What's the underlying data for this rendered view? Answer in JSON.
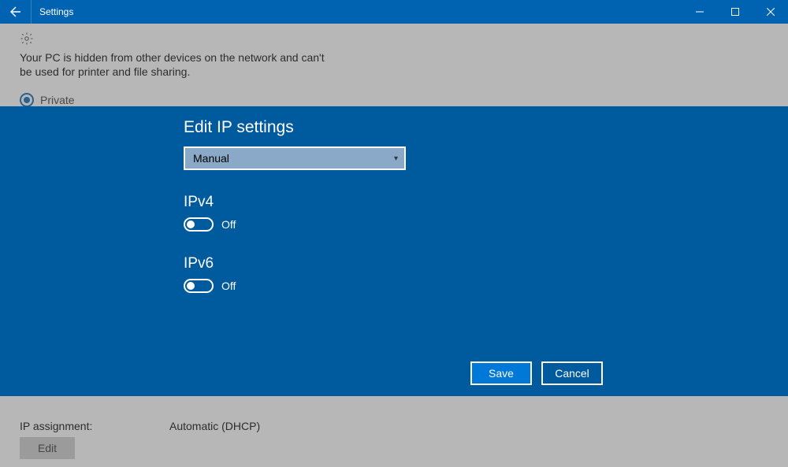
{
  "titlebar": {
    "title": "Settings"
  },
  "background": {
    "description": "Your PC is hidden from other devices on the network and can't be used for printer and file sharing.",
    "radio_private": "Private",
    "ip_assignment_label": "IP assignment:",
    "ip_assignment_value": "Automatic (DHCP)",
    "edit_label": "Edit"
  },
  "modal": {
    "title": "Edit IP settings",
    "dropdown_value": "Manual",
    "ipv4_label": "IPv4",
    "ipv4_state": "Off",
    "ipv6_label": "IPv6",
    "ipv6_state": "Off",
    "save_label": "Save",
    "cancel_label": "Cancel"
  }
}
